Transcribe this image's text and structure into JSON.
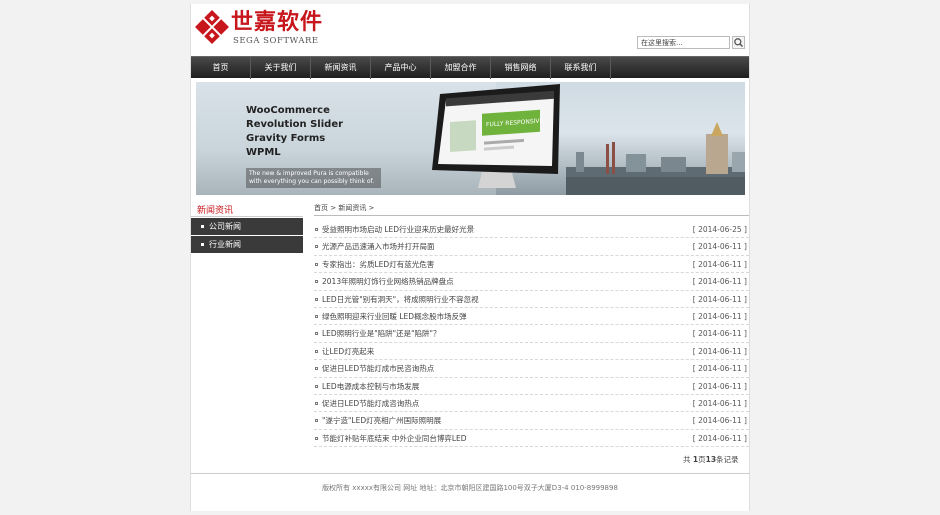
{
  "header": {
    "logo_cn": "世嘉软件",
    "logo_en": "SEGA SOFTWARE",
    "search_placeholder": "在这里搜索...",
    "brand_color": "#c8161d"
  },
  "nav": {
    "items": [
      "首页",
      "关于我们",
      "新闻资讯",
      "产品中心",
      "加盟合作",
      "销售网络",
      "联系我们"
    ]
  },
  "banner": {
    "lines": [
      "WooCommerce",
      "Revolution Slider",
      "Gravity Forms",
      "WPML"
    ],
    "caption": "The new & improved Pura is compatible with everything you can possibly think of.",
    "screen_text": "FULLY RESPONSIVE"
  },
  "sidebar": {
    "title": "新闻资讯",
    "items": [
      "公司新闻",
      "行业新闻"
    ]
  },
  "main": {
    "breadcrumb": "首页 > 新闻资讯 >",
    "news": [
      {
        "title": "受益照明市场启动 LED行业迎来历史最好光景",
        "date": "[ 2014-06-25 ]"
      },
      {
        "title": "光源产品迅速涌入市场并打开局面",
        "date": "[ 2014-06-11 ]"
      },
      {
        "title": "专家指出：劣质LED灯有蓝光危害",
        "date": "[ 2014-06-11 ]"
      },
      {
        "title": "2013年照明灯饰行业网络热销品牌盘点",
        "date": "[ 2014-06-11 ]"
      },
      {
        "title": "LED日光管\"别有洞天\"，将成照明行业不容忽视",
        "date": "[ 2014-06-11 ]"
      },
      {
        "title": "绿色照明迎来行业回暖 LED概念股市场反弹",
        "date": "[ 2014-06-11 ]"
      },
      {
        "title": "LED照明行业是\"陷阱\"还是\"陷阱\"？",
        "date": "[ 2014-06-11 ]"
      },
      {
        "title": "让LED灯亮起来",
        "date": "[ 2014-06-11 ]"
      },
      {
        "title": "促进日LED节能灯成市民咨询热点",
        "date": "[ 2014-06-11 ]"
      },
      {
        "title": "LED电源成本控制与市场发展",
        "date": "[ 2014-06-11 ]"
      },
      {
        "title": "促进日LED节能灯成咨询热点",
        "date": "[ 2014-06-11 ]"
      },
      {
        "title": "\"遂宁造\"LED灯亮相广州国际照明展",
        "date": "[ 2014-06-11 ]"
      },
      {
        "title": "节能灯补贴年底结束 中外企业同台博弈LED",
        "date": "[ 2014-06-11 ]"
      }
    ],
    "pager_prefix": "共",
    "pager_pages": "1",
    "pager_mid": "页",
    "pager_records": "13",
    "pager_suffix": "条记录"
  },
  "footer": {
    "text": "版权所有 xxxxx有限公司 网址 地址：北京市朝阳区建国路100号双子大厦D3-4 010-8999898"
  }
}
